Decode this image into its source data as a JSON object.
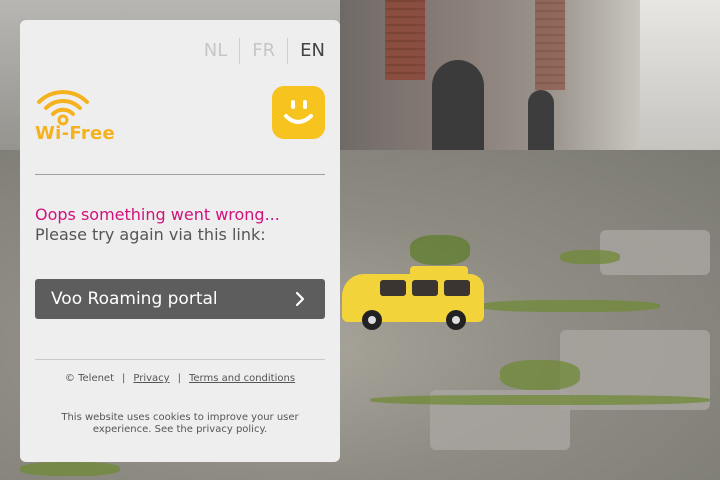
{
  "languages": [
    {
      "code": "NL",
      "active": false
    },
    {
      "code": "FR",
      "active": false
    },
    {
      "code": "EN",
      "active": true
    }
  ],
  "brand": {
    "wifree_logo_text": "Wi-Free",
    "wifree_color": "#f5b21f",
    "telenet_color": "#f7c31f",
    "icons": [
      "wifi-icon",
      "telenet-smiley-icon",
      "chevron-right-icon"
    ]
  },
  "message": {
    "error": "Oops something went wrong...",
    "hint": "Please try again via this link:",
    "error_color": "#d0127b"
  },
  "portal_button": {
    "label": "Voo Roaming portal",
    "color": "#5d5d5d"
  },
  "footer": {
    "copyright": "© Telenet",
    "privacy": "Privacy",
    "terms": "Terms and conditions",
    "cookie_notice": "This website uses cookies to improve your user experience. See the privacy policy."
  }
}
